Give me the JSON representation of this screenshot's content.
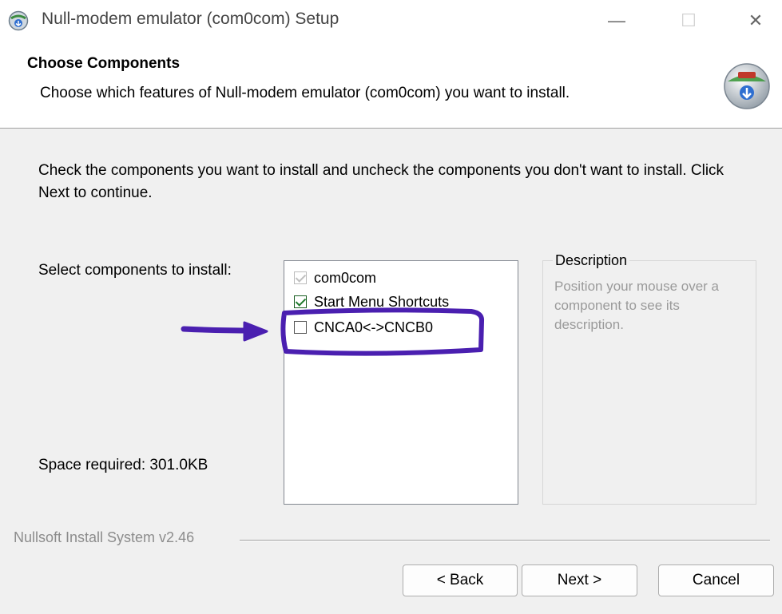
{
  "window": {
    "title": "Null-modem emulator (com0com) Setup",
    "minimize_glyph": "—",
    "maximize_glyph": "☐",
    "close_glyph": "✕"
  },
  "header": {
    "title": "Choose Components",
    "subtitle": "Choose which features of Null-modem emulator (com0com) you want to install."
  },
  "body": {
    "instructions": "Check the components you want to install and uncheck the components you don't want to install. Click Next to continue.",
    "select_label": "Select components to install:",
    "space_required": "Space required: 301.0KB"
  },
  "components": [
    {
      "label": "com0com",
      "state": "checked-disabled"
    },
    {
      "label": "Start Menu Shortcuts",
      "state": "checked"
    },
    {
      "label": "CNCA0<->CNCB0",
      "state": "unchecked"
    }
  ],
  "description": {
    "legend": "Description",
    "text": "Position your mouse over a component to see its description."
  },
  "footer": {
    "branding": "Nullsoft Install System v2.46",
    "back_label": "< Back",
    "next_label": "Next >",
    "cancel_label": "Cancel"
  },
  "icons": {
    "app": "installer-globe-icon",
    "header_logo": "nsis-disk-icon"
  },
  "colors": {
    "annotation": "#4a1fb0",
    "checkmark": "#1f7a2c",
    "panel_bg": "#f0f0f0"
  }
}
